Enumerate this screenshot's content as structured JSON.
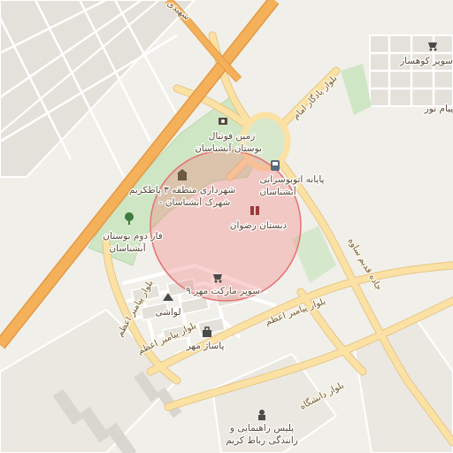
{
  "map": {
    "colors": {
      "background": "#f1efe9",
      "block": "#e4e1da",
      "park": "#cfe6c4",
      "highway": "#f5b05a",
      "highway_casing": "#e29a44",
      "road": "#fbe2a4",
      "road_casing": "#e6c586",
      "minor_road": "#ffffff",
      "circle_fill": "#f08080",
      "circle_stroke": "#e57373"
    },
    "labels": {
      "football": "زمین فوتبال",
      "park_name": "بوستان آبشناسان",
      "municipality_l1": "شهرداری منطقه ۳ پاطکریم",
      "municipality_l2": "- شهرک آبشناسان",
      "terminal_l1": "پایانه اتوبوسرانی",
      "terminal_l2": "آبشناسان",
      "school": "دبستان رضوان",
      "faz_l1": "فاز دوم بوستان",
      "faz_l2": "آبشناسان",
      "supermarket": "سوپر مارکت مهر ۹",
      "lavashi": "لواشی",
      "pasaj": "پاساژ مهر",
      "police_l1": "پلیس راهنمایی و",
      "police_l2": "رانندگی رباط کریم",
      "kowsar": "سوپر کوهسار",
      "payam": "پیام نور"
    },
    "road_labels": {
      "shahidi": "شهیدی",
      "yadegar": "بلوار یادگار امام",
      "jadeh": "جاده قدیم ساوه",
      "payambar1": "بلوار پیامبر اعظم",
      "payambar2": "بلوار پیامبر اعظم",
      "payambar3": "بلوار پیامبر اعظم",
      "daneshgah": "بلوار دانشگاه"
    },
    "icons": {
      "football": "football-pitch-icon",
      "municipality": "town-hall-icon",
      "bus": "bus-station-icon",
      "school": "school-icon",
      "park": "tree-icon",
      "supermarket": "supermarket-cart-icon",
      "bakery": "bakery-icon",
      "mall": "shopping-bag-icon",
      "police": "police-icon",
      "shop": "shop-cart-icon"
    }
  }
}
